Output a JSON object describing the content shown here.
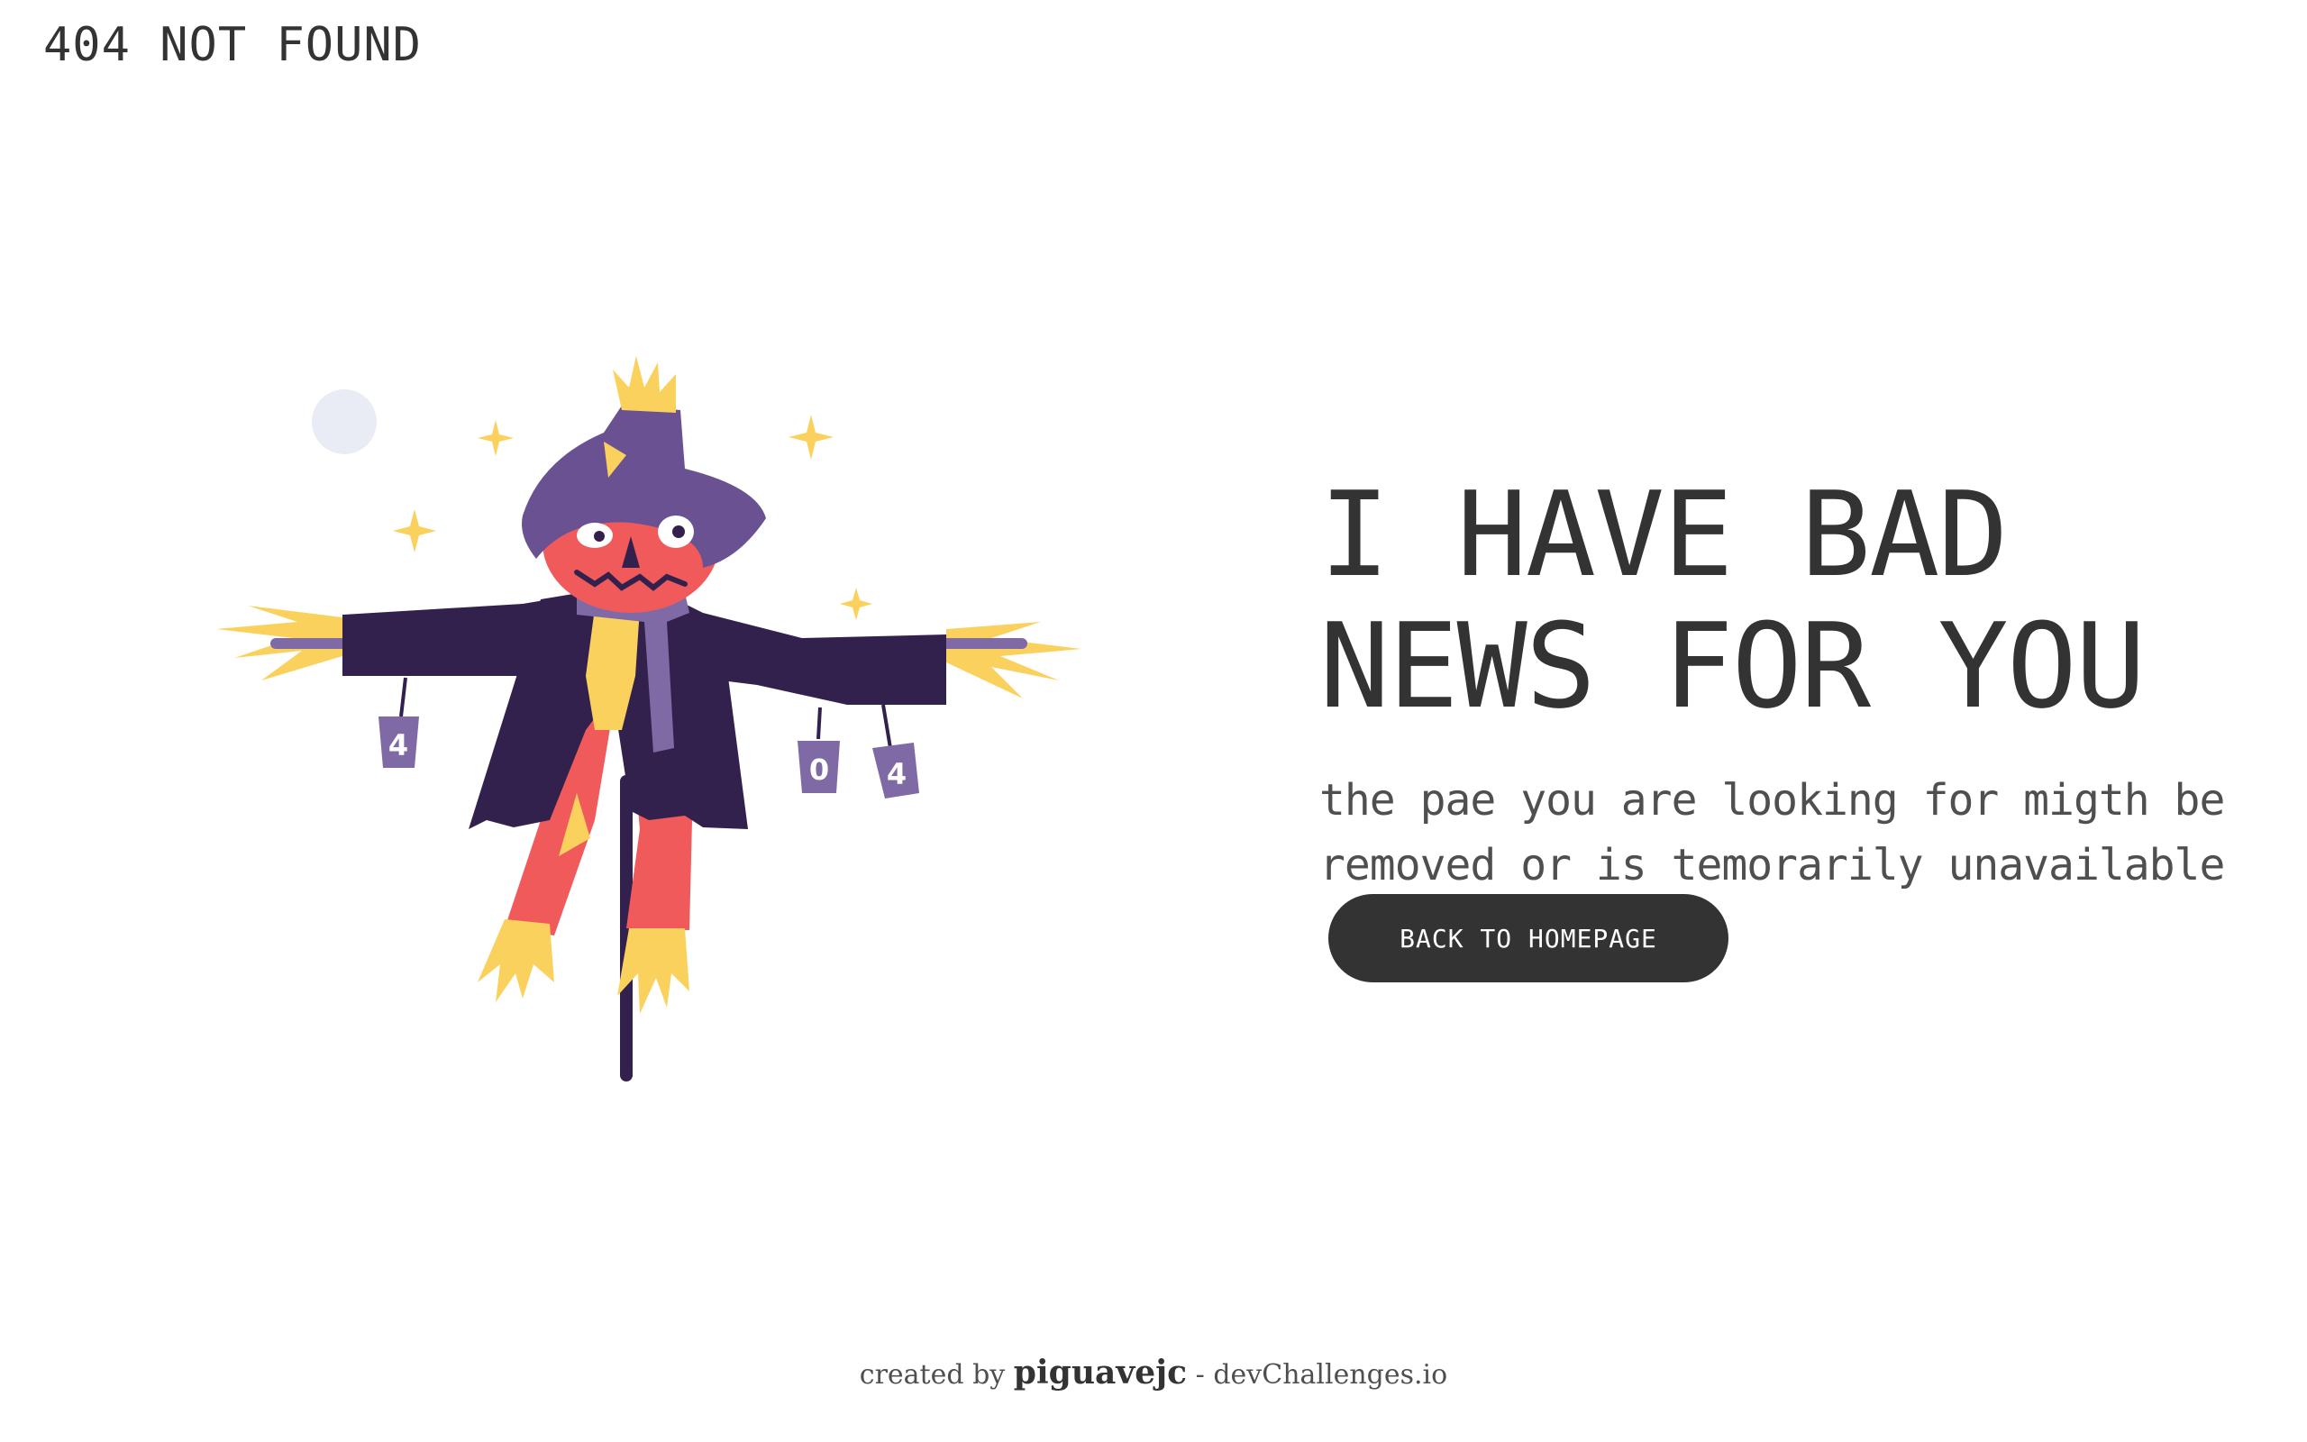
{
  "header": {
    "brand": "404 NOT FOUND"
  },
  "illustration": {
    "cans": [
      "4",
      "0",
      "4"
    ],
    "colors": {
      "hat": "#6a5192",
      "coat": "#33214d",
      "face": "#f05a5b",
      "straw": "#fbd15e",
      "moon": "#e9ecf5",
      "can": "#7f6aa6",
      "pole": "#33214d"
    }
  },
  "main": {
    "headline": [
      "I HAVE BAD",
      "NEWS FOR YOU"
    ],
    "subtext": [
      "the pae you are looking for migth be",
      "removed or is temorarily unavailable"
    ],
    "cta_label": "BACK TO HOMEPAGE"
  },
  "footer": {
    "prefix": "created by",
    "author": "piguavejc",
    "separator": "-",
    "site": "devChallenges.io"
  }
}
